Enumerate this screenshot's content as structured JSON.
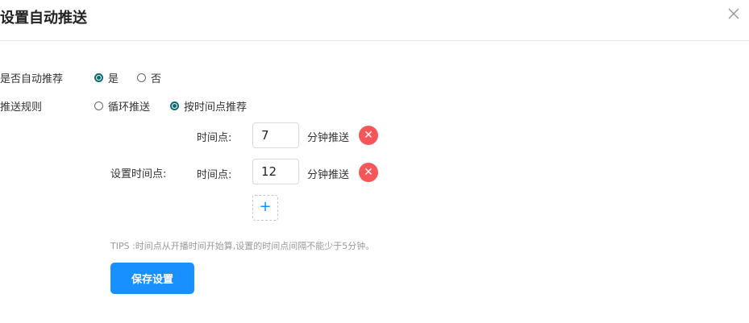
{
  "dialog": {
    "title": "设置自动推送",
    "close_icon": "close-icon"
  },
  "auto_recommend": {
    "label": "是否自动推荐",
    "options": [
      {
        "label": "是",
        "checked": true
      },
      {
        "label": "否",
        "checked": false
      }
    ]
  },
  "push_rule": {
    "label": "推送规则",
    "options": [
      {
        "label": "循环推送",
        "checked": false
      },
      {
        "label": "按时间点推荐",
        "checked": true
      }
    ]
  },
  "time_points": {
    "section_label": "设置时间点:",
    "rows": [
      {
        "label": "时间点:",
        "value": "7",
        "suffix": "分钟推送"
      },
      {
        "label": "时间点:",
        "value": "12",
        "suffix": "分钟推送"
      }
    ],
    "add_label": "+"
  },
  "tips": "TIPS :时间点从开播时间开始算,设置的时间点间隔不能少于5分钟。",
  "save_label": "保存设置",
  "colors": {
    "primary": "#1890ff",
    "radio_checked": "#0a6a74",
    "delete": "#f5565a"
  }
}
